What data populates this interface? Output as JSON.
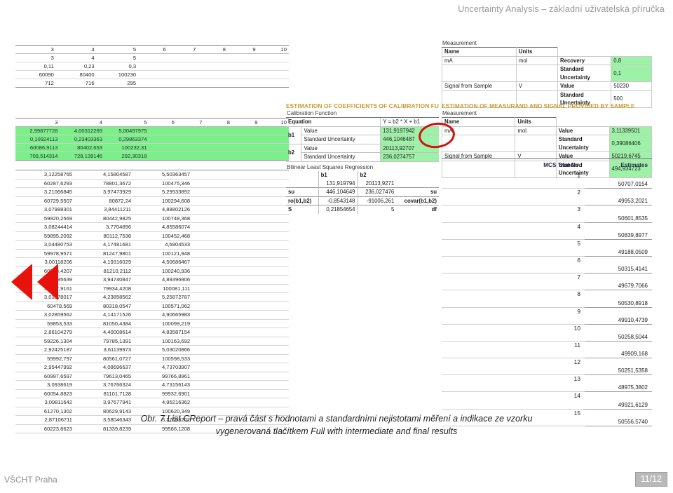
{
  "header": {
    "title": "Uncertainty Analysis – základní uživatelská příručka"
  },
  "footer": {
    "institution": "VŠCHT Praha",
    "page": "11/12"
  },
  "caption": {
    "line1": "Obr. 7  List CReport – pravá část s hodnotami a standardními nejistotami měření a indikace ze vzorku",
    "line2": "vygenerovaná tlačítkem Full with intermediate and final results"
  },
  "colors": {
    "green_highlight": "#9ef2a8",
    "green_band": "#7bf08a",
    "annotation_red": "#e8120c",
    "section_title": "#c99a2e"
  },
  "top_left_table": {
    "headers": [
      "3",
      "4",
      "5",
      "6",
      "7",
      "8",
      "9",
      "10"
    ],
    "rows": [
      [
        "3",
        "4",
        "5",
        "",
        "",
        "",
        "",
        ""
      ],
      [
        "0,11",
        "0,23",
        "0,3",
        "",
        "",
        "",
        "",
        ""
      ],
      [
        "60090",
        "80400",
        "100230",
        "",
        "",
        "",
        "",
        ""
      ],
      [
        "712",
        "716",
        "295",
        "",
        "",
        "",
        "",
        ""
      ]
    ]
  },
  "mid_left_table": {
    "headers": [
      "3",
      "4",
      "5",
      "6",
      "7",
      "8",
      "9",
      "10"
    ],
    "rows": [
      [
        "2,99877728",
        "4,00312269",
        "5,00497975",
        "",
        "",
        "",
        "",
        ""
      ],
      [
        "0,10924113",
        "0,23403363",
        "0,29863374",
        "",
        "",
        "",
        "",
        ""
      ],
      [
        "60086,9113",
        "80402,653",
        "100232,31",
        "",
        "",
        "",
        "",
        ""
      ],
      [
        "709,514314",
        "728,139146",
        "292,30318",
        "",
        "",
        "",
        "",
        ""
      ]
    ]
  },
  "left_data_table": {
    "rows": [
      [
        "3,12258765",
        "4,15804587",
        "5,50363457"
      ],
      [
        "60287,6293",
        "78801,3672",
        "100475,346"
      ],
      [
        "3,21066845",
        "3,97473929",
        "5,29533892"
      ],
      [
        "60729,5507",
        "80872,24",
        "100294,608"
      ],
      [
        "3,07988301",
        "3,84411211",
        "4,88802126"
      ],
      [
        "59920,2569",
        "80442,9825",
        "100748,368"
      ],
      [
        "3,08244414",
        "3,7704896",
        "4,85586074"
      ],
      [
        "59895,2092",
        "80112,7538",
        "100452,468"
      ],
      [
        "3,04480753",
        "4,17481681",
        "4,6904533"
      ],
      [
        "59978,9571",
        "81247,9801",
        "100121,948"
      ],
      [
        "3,00118206",
        "4,19316029",
        "4,50686467"
      ],
      [
        "60213,4207",
        "81210,2112",
        "100240,936"
      ],
      [
        "2,93595639",
        "3,94740847",
        "4,89396906"
      ],
      [
        "59817,9161",
        "79934,4208",
        "100081,111"
      ],
      [
        "3,03978017",
        "4,23858562",
        "5,25872787"
      ],
      [
        "60478,569",
        "80318,0547",
        "100571,062"
      ],
      [
        "3,02859562",
        "4,14171526",
        "4,90665983"
      ],
      [
        "59853,533",
        "81050,4384",
        "100099,219"
      ],
      [
        "2,86104279",
        "4,40008614",
        "4,83587154"
      ],
      [
        "59226,1304",
        "79785,1391",
        "100163,692"
      ],
      [
        "2,92425187",
        "3,61139973",
        "5,03020866"
      ],
      [
        "59992,797",
        "80561,0727",
        "100598,533"
      ],
      [
        "2,95447992",
        "4,08696637",
        "4,73703907"
      ],
      [
        "60997,6597",
        "79613,0465",
        "99766,8961"
      ],
      [
        "3,0938619",
        "3,76766324",
        "4,73156143"
      ],
      [
        "60054,8823",
        "81101,7128",
        "99932,6901"
      ],
      [
        "3,09811642",
        "3,97677941",
        "4,95216362"
      ],
      [
        "61270,1302",
        "80629,9143",
        "100620,349"
      ],
      [
        "2,87106711",
        "3,58046343",
        "5,37103202"
      ],
      [
        "60223,8623",
        "81339,8239",
        "99566,1208"
      ]
    ]
  },
  "measurement_top": {
    "title": "Measurement",
    "headers": {
      "name": "Name",
      "units": "Units"
    },
    "rows": [
      {
        "name": "mA",
        "units": "mol",
        "key": "Recovery",
        "value": "0,8",
        "highlight": true
      },
      {
        "name": "",
        "units": "",
        "key": "Standard Uncertainty",
        "value": "0,1",
        "highlight": true
      },
      {
        "name": "Signal from Sample",
        "units": "V",
        "key": "Value",
        "value": "50230",
        "highlight": false
      },
      {
        "name": "",
        "units": "",
        "key": "Standard Uncertainty",
        "value": "500",
        "highlight": false
      }
    ]
  },
  "calibration_section": {
    "title": "ESTIMATION OF COEFFICIENTS OF CALIBRATION FU",
    "subtitle": "Calibration Function",
    "equation_label": "Equation",
    "equation_value": "Y = b2 * X + b1",
    "rows": [
      {
        "coef": "b1",
        "key": "Value",
        "value": "131,9197942"
      },
      {
        "coef": "b1",
        "key": "Standard Uncertainty",
        "value": "446,1046487"
      },
      {
        "coef": "b2",
        "key": "Value",
        "value": "20113,92707"
      },
      {
        "coef": "b2",
        "key": "Standard Uncertainty",
        "value": "236,0274757"
      }
    ]
  },
  "blsr_section": {
    "title": "Bilinear Least Squares Regression",
    "col_b1": "b1",
    "col_b2": "b2",
    "rows": [
      {
        "left": "",
        "b1": "131,919794",
        "b2": "20113,9271",
        "right": ""
      },
      {
        "left": "su",
        "b1": "446,104649",
        "b2": "236,027476",
        "right": "su"
      },
      {
        "left": "ro(b1,b2)",
        "b1": "-0,8543148",
        "b2": "-91006,261",
        "right": "covar(b1,b2)"
      },
      {
        "left": "S",
        "b1": "0,21854654",
        "b2": "5",
        "right": "df"
      }
    ]
  },
  "measurand_section": {
    "title": "ESTIMATION OF MEASURAND AND SIGNAL PROVIDED BY SAMPLE",
    "subtitle": "Measurement",
    "headers": {
      "name": "Name",
      "units": "Units"
    },
    "rows": [
      {
        "name": "mA",
        "units": "mol",
        "key": "Value",
        "value": "3,11339501"
      },
      {
        "name": "",
        "units": "",
        "key": "Standard Uncertainty",
        "value": "0,39086406"
      },
      {
        "name": "Signal from Sample",
        "units": "V",
        "key": "Value",
        "value": "50219,6745"
      },
      {
        "name": "",
        "units": "",
        "key": "Standard Uncertainty",
        "value": "494,934723"
      }
    ]
  },
  "mcs_table": {
    "headers": {
      "trial": "MCS Trial No.",
      "estimates": "Estimates"
    },
    "rows": [
      {
        "no": "1",
        "estimate": "50707,0154"
      },
      {
        "no": "2",
        "estimate": "49953,2021"
      },
      {
        "no": "3",
        "estimate": "50601,8535"
      },
      {
        "no": "4",
        "estimate": "50839,8977"
      },
      {
        "no": "5",
        "estimate": "49188,0509"
      },
      {
        "no": "6",
        "estimate": "50315,4141"
      },
      {
        "no": "7",
        "estimate": "49679,7066"
      },
      {
        "no": "8",
        "estimate": "50530,8918"
      },
      {
        "no": "9",
        "estimate": "49910,4739"
      },
      {
        "no": "10",
        "estimate": "50258,5044"
      },
      {
        "no": "11",
        "estimate": "49909,168"
      },
      {
        "no": "12",
        "estimate": "50251,5358"
      },
      {
        "no": "13",
        "estimate": "48975,3802"
      },
      {
        "no": "14",
        "estimate": "49921,6129"
      },
      {
        "no": "15",
        "estimate": "50556,5740"
      }
    ]
  }
}
